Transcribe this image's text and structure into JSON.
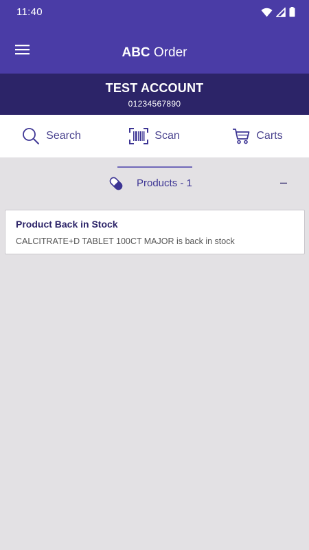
{
  "status_bar": {
    "time": "11:40",
    "icons": [
      "wifi-icon",
      "signal-icon",
      "battery-icon"
    ]
  },
  "app_bar": {
    "title_bold": "ABC",
    "title_rest": " Order",
    "menu_icon": "hamburger-menu-icon"
  },
  "account": {
    "name": "TEST ACCOUNT",
    "number": "01234567890"
  },
  "actions": [
    {
      "label": "Search",
      "icon": "search-icon"
    },
    {
      "label": "Scan",
      "icon": "barcode-scan-icon"
    },
    {
      "label": "Carts",
      "icon": "cart-icon"
    }
  ],
  "section": {
    "label": "Products - 1",
    "icon": "pill-icon",
    "toggle": "–"
  },
  "notices": [
    {
      "title": "Product Back in Stock",
      "body": "CALCITRATE+D TABLET 100CT MAJOR is back in stock"
    }
  ],
  "colors": {
    "primary": "#4a3ca6",
    "primary_dark": "#2c2468",
    "accent_text": "#3d3594",
    "background": "#e3e1e4"
  }
}
